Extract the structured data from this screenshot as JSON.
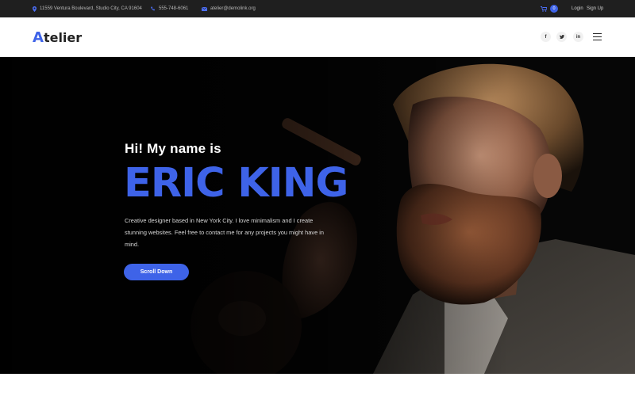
{
  "topbar": {
    "address": "11559 Ventura Boulevard, Studio City, CA 91604",
    "phone": "555-748-6061",
    "email": "atelier@demolink.org",
    "cart_count": "0",
    "login_label": "Login",
    "signup_label": "Sign Up",
    "icons": [
      "location-pin-icon",
      "phone-icon",
      "mail-icon",
      "cart-icon"
    ]
  },
  "header": {
    "logo_mark": "A",
    "logo_rest": "telier",
    "social": [
      {
        "name": "facebook",
        "glyph": "f"
      },
      {
        "name": "twitter",
        "glyph": "t"
      },
      {
        "name": "linkedin",
        "glyph": "in"
      }
    ]
  },
  "hero": {
    "greeting": "Hi! My name is",
    "name": "ERIC KING",
    "description": "Creative designer based in New York City. I love minimalism and I create stunning websites. Feel free to contact me for any projects you might have in mind.",
    "cta_label": "Scroll Down"
  },
  "colors": {
    "accent": "#3e63e8",
    "topbar_bg": "#1f1f1f",
    "hero_bg": "#050505"
  }
}
